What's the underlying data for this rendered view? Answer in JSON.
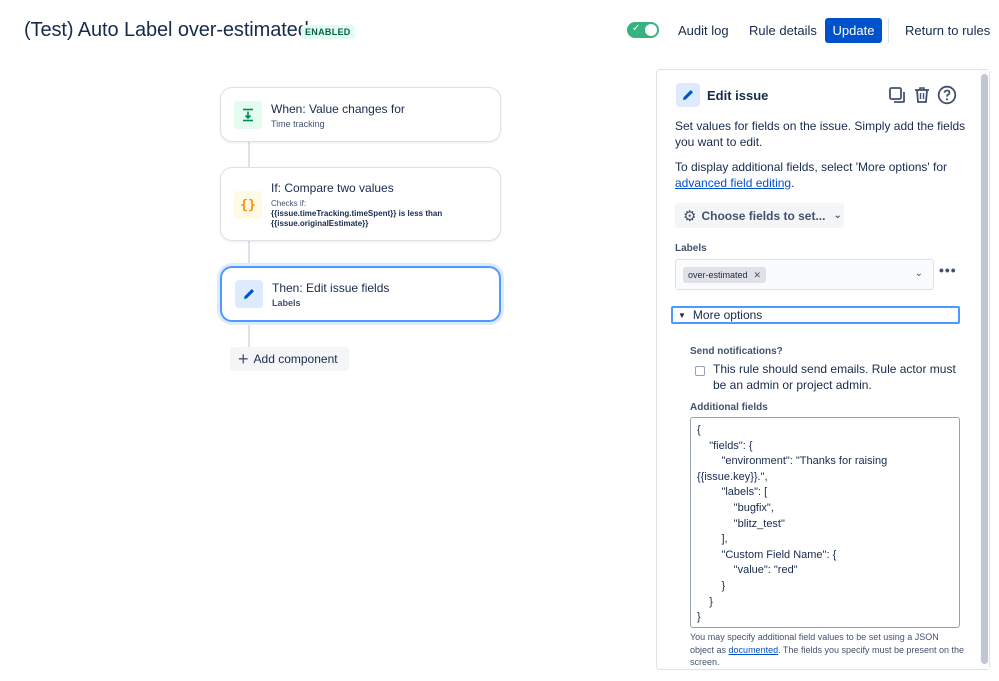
{
  "header": {
    "title": "(Test) Auto Label over-estimated",
    "status": "ENABLED",
    "toggle_checked": true,
    "audit_log": "Audit log",
    "rule_details": "Rule details",
    "update": "Update",
    "return_to_rules": "Return to rules"
  },
  "flow": {
    "trigger": {
      "title": "When: Value changes for",
      "subtitle": "Time tracking",
      "icon": "value-change-icon"
    },
    "condition": {
      "title": "If: Compare two values",
      "checks_label": "Checks if:",
      "expr1": "{{issue.timeTracking.timeSpent}}",
      "op": "is less than",
      "expr2": "{{issue.originalEstimate}}",
      "icon": "braces-icon"
    },
    "action": {
      "title": "Then: Edit issue fields",
      "subtitle": "Labels",
      "icon": "pencil-icon"
    },
    "add_component": "Add component"
  },
  "panel": {
    "title": "Edit issue",
    "description": "Set values for fields on the issue. Simply add the fields you want to edit.",
    "more_prefix": "To display additional fields, select 'More options' for",
    "more_link": "advanced field editing",
    "more_suffix": ".",
    "choose_fields": "Choose fields to set...",
    "labels_label": "Labels",
    "labels_value": "over-estimated",
    "more_options": "More options",
    "send_notifications_label": "Send notifications?",
    "send_notifications_text": "This rule should send emails. Rule actor must be an admin or project admin.",
    "send_notifications_checked": false,
    "additional_fields_label": "Additional fields",
    "additional_fields_json": "{\n    \"fields\": {\n        \"environment\": \"Thanks for raising\n{{issue.key}}.\",\n        \"labels\": [\n            \"bugfix\",\n            \"blitz_test\"\n        ],\n        \"Custom Field Name\": {\n            \"value\": \"red\"\n        }\n    }\n}",
    "help_prefix": "You may specify additional field values to be set using a JSON object as",
    "help_link": "documented",
    "help_suffix": ". The fields you specify must be present on the screen."
  },
  "colors": {
    "primary": "#0052cc",
    "toggle_on": "#36b37e",
    "selected_border": "#4c9aff",
    "badge_bg": "#e3fcef",
    "badge_text": "#006644"
  }
}
